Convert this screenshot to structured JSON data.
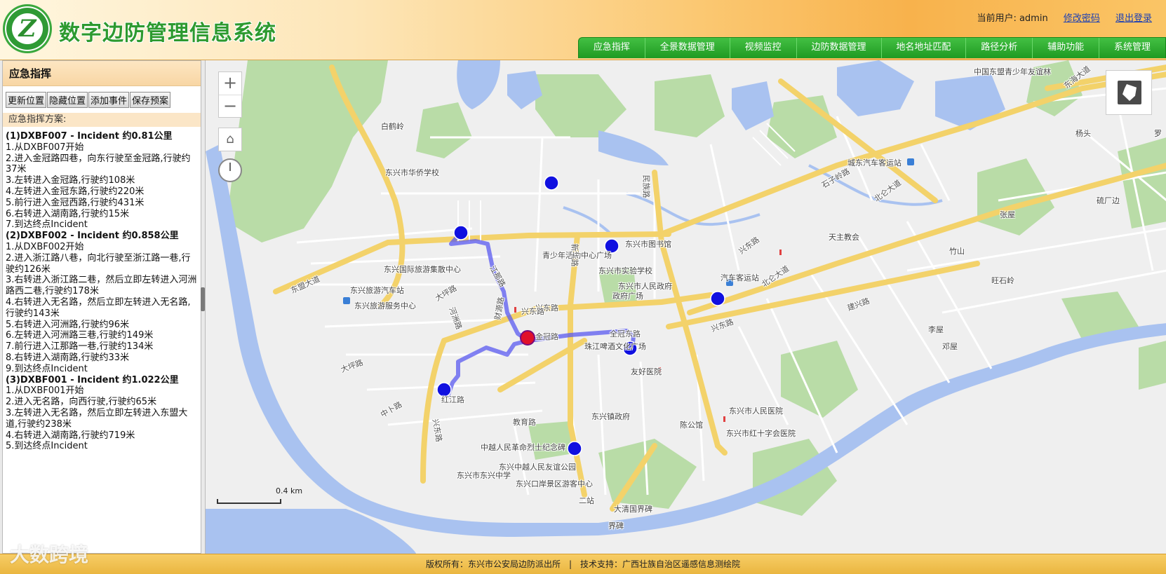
{
  "header": {
    "app_title": "数字边防管理信息系统",
    "logo_letter": "Z",
    "user_label": "当前用户: admin",
    "change_password": "修改密码",
    "logout": "退出登录"
  },
  "nav": {
    "items": [
      {
        "label": "应急指挥"
      },
      {
        "label": "全景数据管理"
      },
      {
        "label": "视频监控"
      },
      {
        "label": "边防数据管理"
      },
      {
        "label": "地名地址匹配"
      },
      {
        "label": "路径分析"
      },
      {
        "label": "辅助功能"
      },
      {
        "label": "系统管理"
      }
    ]
  },
  "sidebar": {
    "title": "应急指挥",
    "buttons": {
      "update": "更新位置",
      "hide": "隐藏位置",
      "add_event": "添加事件",
      "save_plan": "保存预案"
    },
    "plan_label": "应急指挥方案:",
    "plans": [
      {
        "head": "(1)DXBF007 - Incident 约0.81公里",
        "steps": [
          "1.从DXBF007开始",
          "2.进入金冠路四巷，向东行驶至金冠路,行驶约37米",
          "3.左转进入金冠路,行驶约108米",
          "4.左转进入金冠东路,行驶约220米",
          "5.前行进入金冠西路,行驶约431米",
          "6.右转进入湖南路,行驶约15米",
          "7.到达终点Incident"
        ]
      },
      {
        "head": "(2)DXBF002 - Incident 约0.858公里",
        "steps": [
          "1.从DXBF002开始",
          "2.进入浙江路八巷，向北行驶至浙江路一巷,行驶约126米",
          "3.右转进入浙江路二巷，然后立即左转进入河洲路西二巷,行驶约178米",
          "4.右转进入无名路，然后立即左转进入无名路,行驶约143米",
          "5.右转进入河洲路,行驶约96米",
          "6.左转进入河洲路三巷,行驶约149米",
          "7.前行进入江那路一巷,行驶约134米",
          "8.右转进入湖南路,行驶约33米",
          "9.到达终点Incident"
        ]
      },
      {
        "head": "(3)DXBF001 - Incident 约1.022公里",
        "steps": [
          "1.从DXBF001开始",
          "2.进入无名路，向西行驶,行驶约65米",
          "3.左转进入无名路，然后立即左转进入东盟大道,行驶约238米",
          "4.右转进入湖南路,行驶约719米",
          "5.到达终点Incident"
        ]
      }
    ]
  },
  "map": {
    "scale_label": "0.4 km",
    "labels": {
      "l01": "白鹤岭",
      "l02": "东兴市华侨学校",
      "l03": "中国东盟青少年友谊林",
      "l04": "东海大道",
      "l05": "民族路",
      "l06": "城东汽车客运站",
      "l07": "东兴市图书馆",
      "l08": "青少年活动中心广场",
      "l09": "东兴市实验学校",
      "l10": "东兴市人民政府",
      "l11": "政府广场",
      "l12": "东兴国际旅游集散中心",
      "l13": "东兴旅游汽车站",
      "l14": "东兴旅游服务中心",
      "l15": "东盟大道",
      "l16": "兴东路",
      "l17": "珠江啤酒文化广场",
      "l18": "友好医院",
      "l19": "北仑大道",
      "l20": "汽车客运站",
      "l21": "天主教会",
      "l22": "竹山",
      "l23": "建兴路",
      "l24": "东兴市人民医院",
      "l25": "东兴市红十字会医院",
      "l26": "陈公馆",
      "l27": "东兴镇政府",
      "l28": "中越人民革命烈士纪念碑",
      "l29": "东兴中越人民友谊公园",
      "l30": "东兴市东兴中学",
      "l31": "东兴口岸景区游客中心",
      "l32": "大清国界碑",
      "l33": "兴东路",
      "l34": "大坪路",
      "l35": "中卜路",
      "l36": "教育路",
      "l37": "兴东路",
      "l38": "北仑大道",
      "l39": "石子岭路",
      "l40": "兴东路",
      "l41": "新华路",
      "l42": "红江路",
      "l43": "大坪路",
      "l44": "财源路",
      "l45": "金冠路",
      "l46": "全冠东路",
      "l47": "李屋",
      "l48": "邓屋",
      "l49": "旺石岭",
      "l50": "张屋",
      "l51": "硫厂边",
      "l52": "杨头",
      "l53": "兴东路",
      "l54": "罗",
      "l55": "河洲路",
      "l56": "江那路",
      "l57": "界碑",
      "l58": "二站"
    }
  },
  "footer": {
    "text": "版权所有：东兴市公安局边防派出所　|　技术支持：广西壮族自治区遥感信息测绘院"
  },
  "watermark": {
    "text": "大数跨境"
  },
  "colors": {
    "nav_green": "#2aa82d",
    "route_blue": "#5a5af0",
    "marker_blue": "#1010e0",
    "incident_red": "#e0102a",
    "water": "#a9c2f0",
    "green_area": "#b7dca6",
    "road_major": "#f3d26a"
  }
}
